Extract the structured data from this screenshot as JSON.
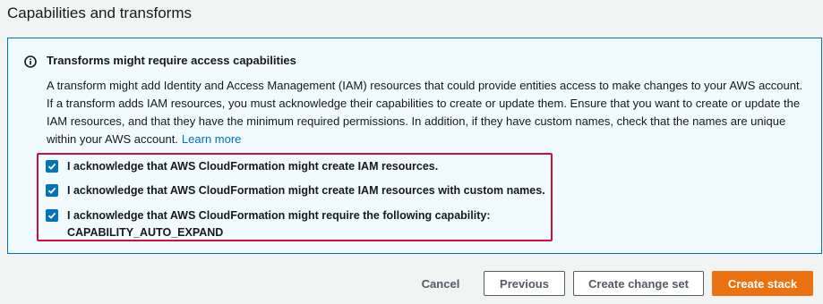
{
  "section": {
    "title": "Capabilities and transforms"
  },
  "info": {
    "icon": "info-icon",
    "title": "Transforms might require access capabilities",
    "body": "A transform might add Identity and Access Management (IAM) resources that could provide entities access to make changes to your AWS account. If a transform adds IAM resources, you must acknowledge their capabilities to create or update them. Ensure that you want to create or update the IAM resources, and that they have the minimum required permissions. In addition, if they have custom names, check that the names are unique within your AWS account.",
    "link": "Learn more",
    "accent_color": "#0073bb",
    "background_color": "#f1faff"
  },
  "acknowledgements": [
    {
      "label": "I acknowledge that AWS CloudFormation might create IAM resources.",
      "checked": true
    },
    {
      "label": "I acknowledge that AWS CloudFormation might create IAM resources with custom names.",
      "checked": true
    },
    {
      "label": "I acknowledge that AWS CloudFormation might require the following capability:",
      "label_line2": "CAPABILITY_AUTO_EXPAND",
      "checked": true
    }
  ],
  "highlight_color": "#d0103a",
  "buttons": {
    "cancel": "Cancel",
    "previous": "Previous",
    "create_change_set": "Create change set",
    "create_stack": "Create stack"
  },
  "primary_color": "#ec7211"
}
